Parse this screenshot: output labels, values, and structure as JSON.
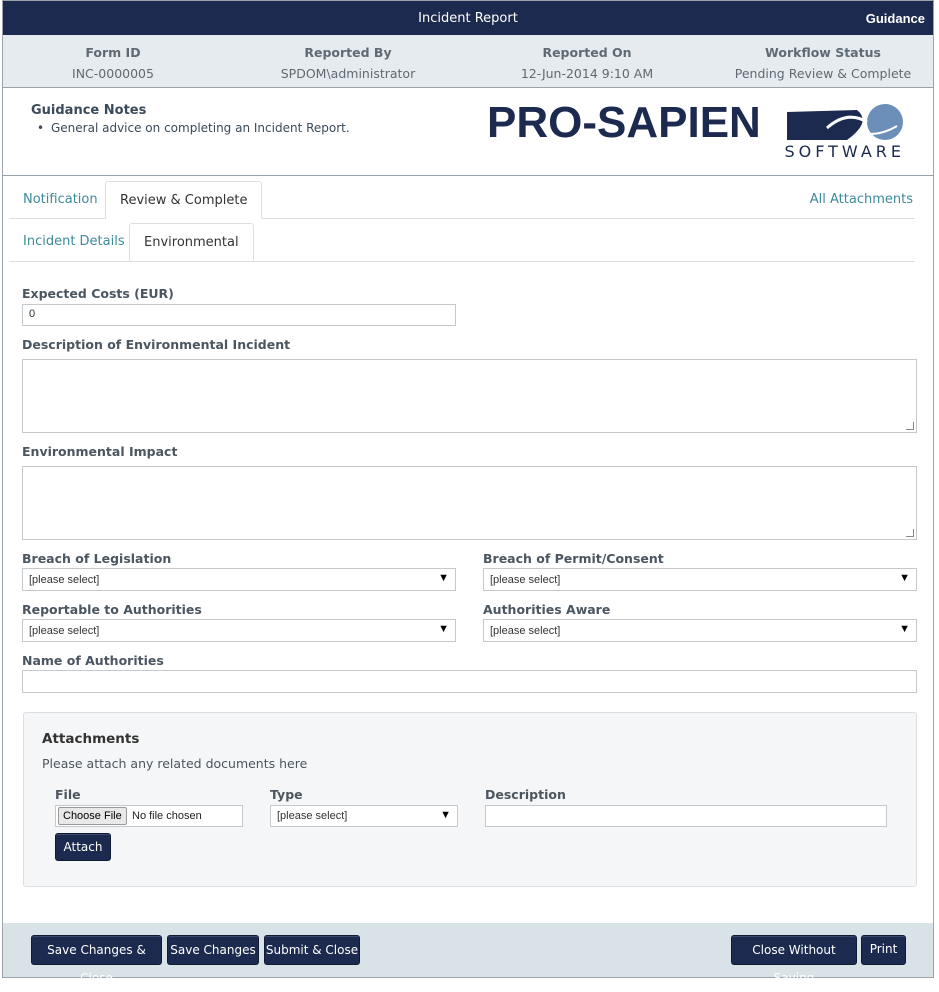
{
  "header": {
    "title": "Incident Report",
    "guidance_label": "Guidance"
  },
  "summary": [
    {
      "label": "Form ID",
      "value": "INC-0000005"
    },
    {
      "label": "Reported By",
      "value": "SPDOM\\administrator"
    },
    {
      "label": "Reported On",
      "value": "12-Jun-2014 9:10 AM"
    },
    {
      "label": "Workflow Status",
      "value": "Pending Review & Complete"
    }
  ],
  "guidance": {
    "title": "Guidance Notes",
    "items": [
      "General advice on completing an Incident Report."
    ]
  },
  "logo": {
    "name": "PRO-SAPIEN",
    "sub": "SOFTWARE"
  },
  "tabs": {
    "main": [
      {
        "label": "Notification"
      },
      {
        "label": "Review & Complete"
      }
    ],
    "all_attachments": "All Attachments",
    "sub": [
      {
        "label": "Incident Details"
      },
      {
        "label": "Environmental"
      }
    ]
  },
  "form": {
    "expected_costs": {
      "label": "Expected Costs (EUR)",
      "value": "0"
    },
    "description": {
      "label": "Description of Environmental Incident",
      "value": ""
    },
    "impact": {
      "label": "Environmental Impact",
      "value": ""
    },
    "breach_legislation": {
      "label": "Breach of Legislation",
      "value": "[please select]"
    },
    "breach_permit": {
      "label": "Breach of Permit/Consent",
      "value": "[please select]"
    },
    "reportable": {
      "label": "Reportable to Authorities",
      "value": "[please select]"
    },
    "authorities_aware": {
      "label": "Authorities Aware",
      "value": "[please select]"
    },
    "authority_names": {
      "label": "Name of Authorities",
      "value": ""
    }
  },
  "attachments": {
    "title": "Attachments",
    "desc": "Please attach any related documents here",
    "file_label": "File",
    "choose_file": "Choose File",
    "no_file": "No file chosen",
    "type_label": "Type",
    "type_value": "[please select]",
    "description_label": "Description",
    "attach_button": "Attach"
  },
  "footer": {
    "save_close": "Save Changes & Close",
    "save": "Save Changes",
    "submit_close": "Submit & Close",
    "close_no_save": "Close Without Saving",
    "print": "Print"
  },
  "colors": {
    "navy": "#1b2a4e",
    "link": "#3d8a9a",
    "panel": "#e6ebef",
    "footer": "#d9e2e6"
  }
}
